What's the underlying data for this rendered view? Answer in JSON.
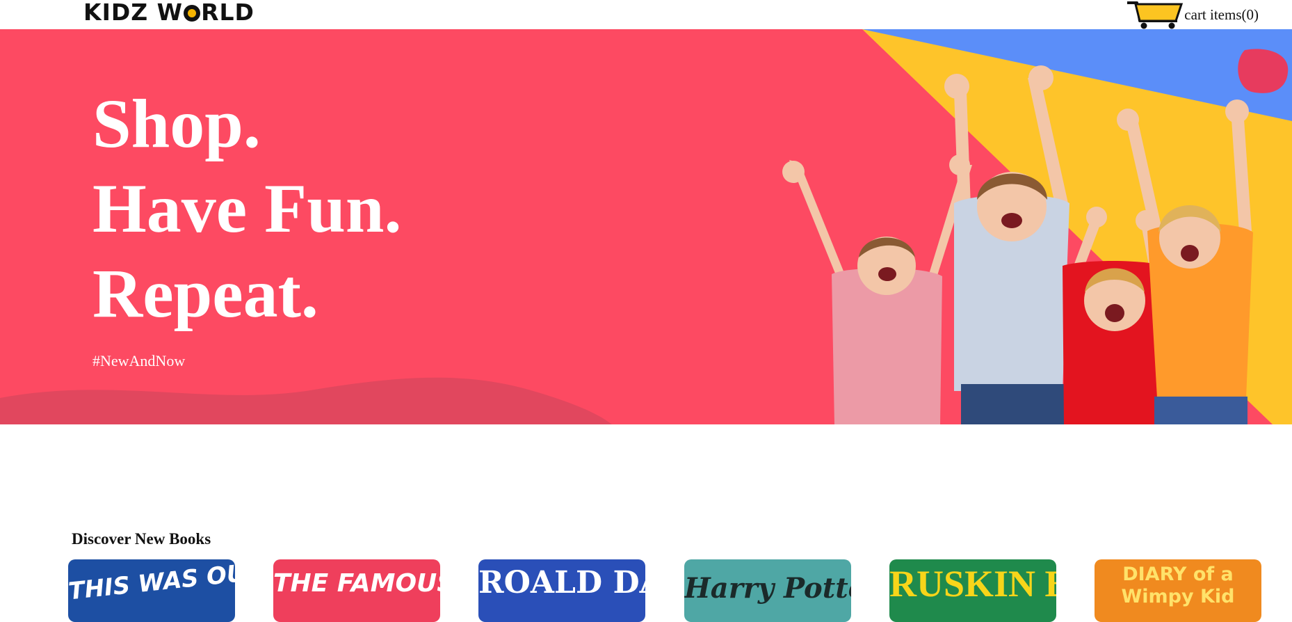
{
  "header": {
    "logo": {
      "part1": "KIDZ W",
      "part2": "RLD"
    },
    "cart_label": "cart items(0)"
  },
  "hero": {
    "lines": [
      "Shop.",
      "Have Fun.",
      "Repeat."
    ],
    "hashtag": "#NewAndNow"
  },
  "books_section": {
    "title": "Discover New Books",
    "books": [
      {
        "cover_text": "THIS WAS OUR PACT",
        "bg": "#1d4fa3",
        "fg": "#ffffff"
      },
      {
        "cover_text": "THE FAMOUS",
        "bg": "#ef3f5c",
        "fg": "#ffffff"
      },
      {
        "cover_text": "ROALD DAHL",
        "bg": "#2a4fb8",
        "fg": "#ffffff"
      },
      {
        "cover_text": "Harry Potter",
        "bg": "#4fa7a5",
        "fg": "#1b2a2a"
      },
      {
        "cover_text": "RUSKIN BOND",
        "bg": "#1f8a4c",
        "fg": "#f7d51a"
      },
      {
        "cover_text": "DIARY of a Wimpy Kid",
        "bg": "#f08a1f",
        "fg": "#ffe26a"
      }
    ]
  },
  "colors": {
    "hero_bg": "#fd4a62",
    "hero_wave": "#e1475e",
    "accent_yellow": "#fec42a",
    "accent_blue": "#5b8ef9",
    "cart_yellow": "#fcc421"
  }
}
